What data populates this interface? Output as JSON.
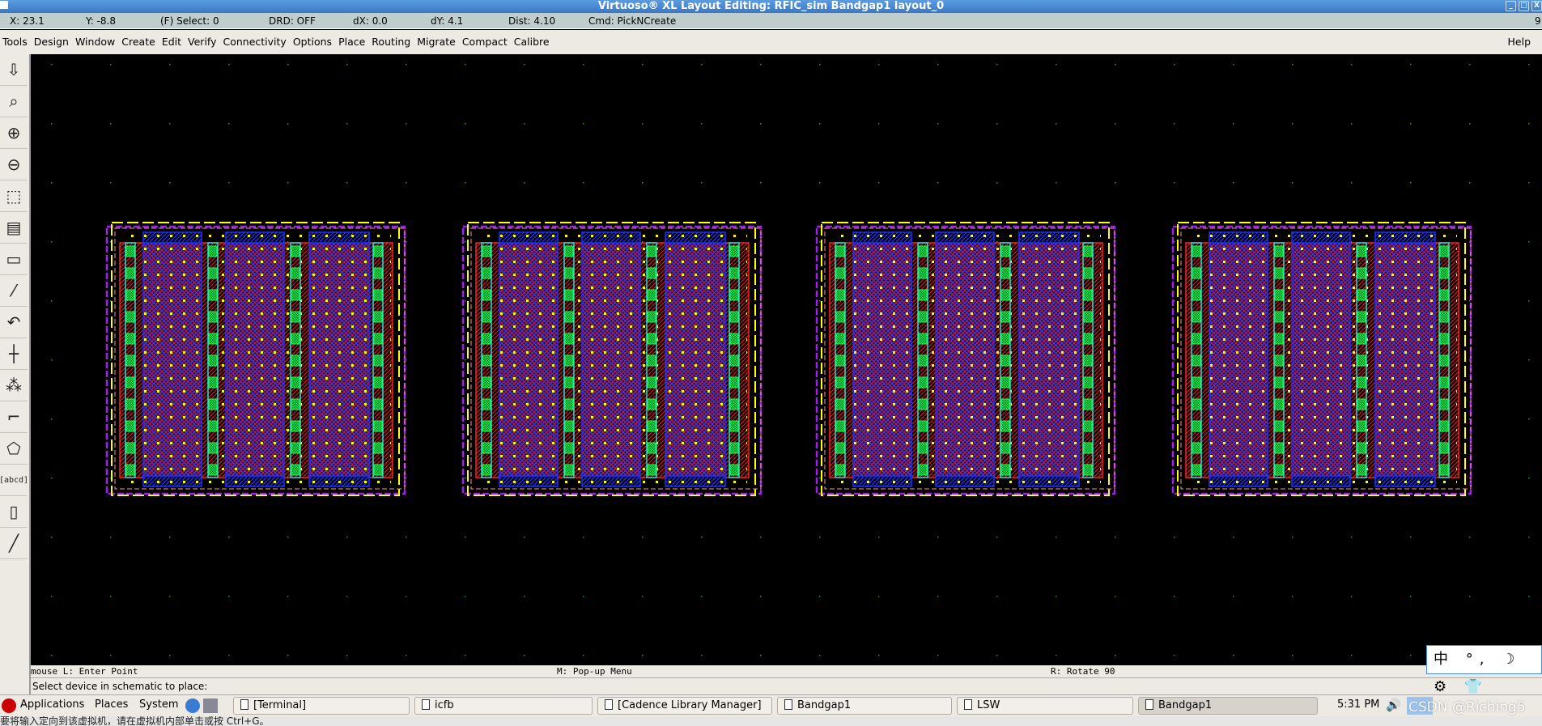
{
  "window": {
    "title": "Virtuoso® XL Layout Editing: RFIC_sim Bandgap1 layout_0",
    "minimize": "_",
    "maximize": "□",
    "close": "X"
  },
  "coords": {
    "x": "X: 23.1",
    "y": "Y: -8.8",
    "select": "(F) Select: 0",
    "drd": "DRD: OFF",
    "dx": "dX: 0.0",
    "dy": "dY: 4.1",
    "dist": "Dist: 4.10",
    "cmd": "Cmd: PickNCreate",
    "right": "9"
  },
  "menu": {
    "items": [
      "Tools",
      "Design",
      "Window",
      "Create",
      "Edit",
      "Verify",
      "Connectivity",
      "Options",
      "Place",
      "Routing",
      "Migrate",
      "Compact",
      "Calibre"
    ],
    "help": "Help"
  },
  "toolbar": {
    "icons": [
      "save-icon",
      "fit-view-icon",
      "zoom-in-icon",
      "zoom-out-icon",
      "stretch-icon",
      "copy-icon",
      "move-icon",
      "path-icon",
      "undo-icon",
      "ruler-grid-icon",
      "properties-icon",
      "route-icon",
      "polygon-icon",
      "label-icon",
      "select-icon",
      "ruler-icon"
    ],
    "label_text": "[abcd]"
  },
  "layout": {
    "cell_count": 4,
    "colors": {
      "metal_red": "#ff2020",
      "diff_blue": "#2030ff",
      "contact_yellow": "#ffff00",
      "gate_green": "#20ff40",
      "outline_cyan": "#20e0e0",
      "boundary_purple": "#a020f0",
      "boundary_pink": "#ff9090",
      "grid_green": "#20a020"
    }
  },
  "status": {
    "mouse_l": "mouse L: Enter Point",
    "mouse_m": "M: Pop-up Menu",
    "mouse_r": "R: Rotate 90",
    "prompt": "Select device in schematic to place:"
  },
  "taskbar": {
    "applications": "Applications",
    "places": "Places",
    "system": "System",
    "windows": [
      "[Terminal]",
      "icfb",
      "[Cadence Library Manager]",
      "Bandgap1",
      "LSW",
      "Bandgap1"
    ],
    "clock": "5:31 PM"
  },
  "ime": {
    "text": "中 °, ☽ ⚙ 👕"
  },
  "watermark": "CSDN @Riching5",
  "vm_hint": "要将输入定向到该虚拟机，请在虚拟机内部单击或按 Ctrl+G。"
}
